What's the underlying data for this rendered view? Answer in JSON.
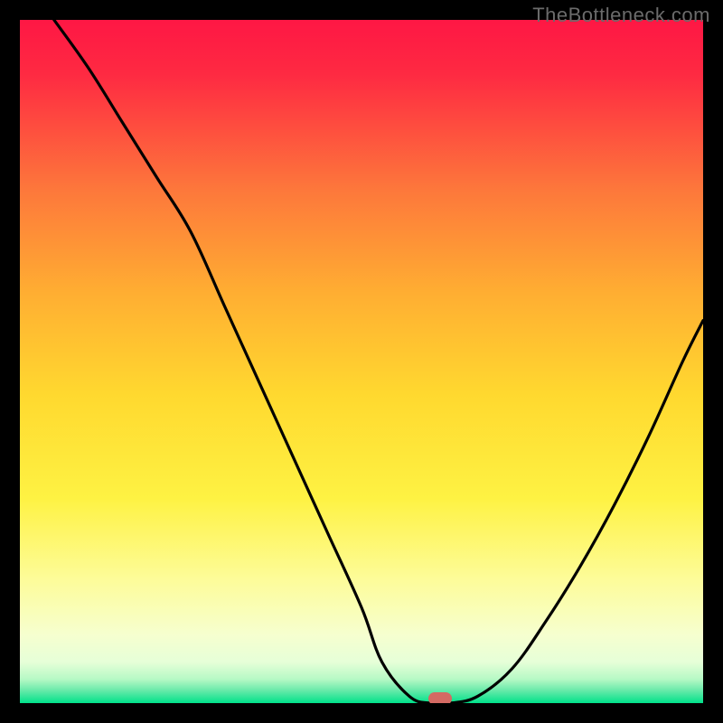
{
  "watermark": "TheBottleneck.com",
  "colors": {
    "frame": "#000000",
    "watermark": "#6b6b6b",
    "curve": "#000000",
    "marker": "#d46a63",
    "gradient_top": "#fe1744",
    "gradient_upper_mid": "#fd783b",
    "gradient_mid": "#ffd92f",
    "gradient_lower_mid": "#fdfc9a",
    "gradient_near_bottom": "#f3ffdd",
    "gradient_bottom": "#00e18a"
  },
  "chart_data": {
    "type": "line",
    "title": "",
    "xlabel": "",
    "ylabel": "",
    "xlim": [
      0,
      100
    ],
    "ylim": [
      0,
      100
    ],
    "x": [
      5,
      10,
      15,
      20,
      25,
      30,
      35,
      40,
      45,
      50,
      53,
      57,
      60,
      63,
      67,
      72,
      77,
      82,
      87,
      92,
      97,
      100
    ],
    "values": [
      100,
      93,
      85,
      77,
      69,
      58,
      47,
      36,
      25,
      14,
      6,
      1,
      0,
      0,
      1,
      5,
      12,
      20,
      29,
      39,
      50,
      56
    ],
    "optimal_x": 61.5,
    "description": "V-shaped bottleneck curve on a heat-map gradient. Minimum (best match) occurs around x≈61 with value≈0. Curve starts at 100 on the left, drops steeply with a knee near x≈27, reaches the floor around x≈60–63, then rises again toward the right edge reaching ≈56 at x=100.",
    "gradient_stops": [
      {
        "offset": 0.0,
        "value": 100
      },
      {
        "offset": 0.25,
        "value": 75
      },
      {
        "offset": 0.5,
        "value": 50
      },
      {
        "offset": 0.72,
        "value": 28
      },
      {
        "offset": 0.86,
        "value": 14
      },
      {
        "offset": 0.93,
        "value": 7
      },
      {
        "offset": 0.975,
        "value": 2.5
      },
      {
        "offset": 1.0,
        "value": 0
      }
    ]
  }
}
